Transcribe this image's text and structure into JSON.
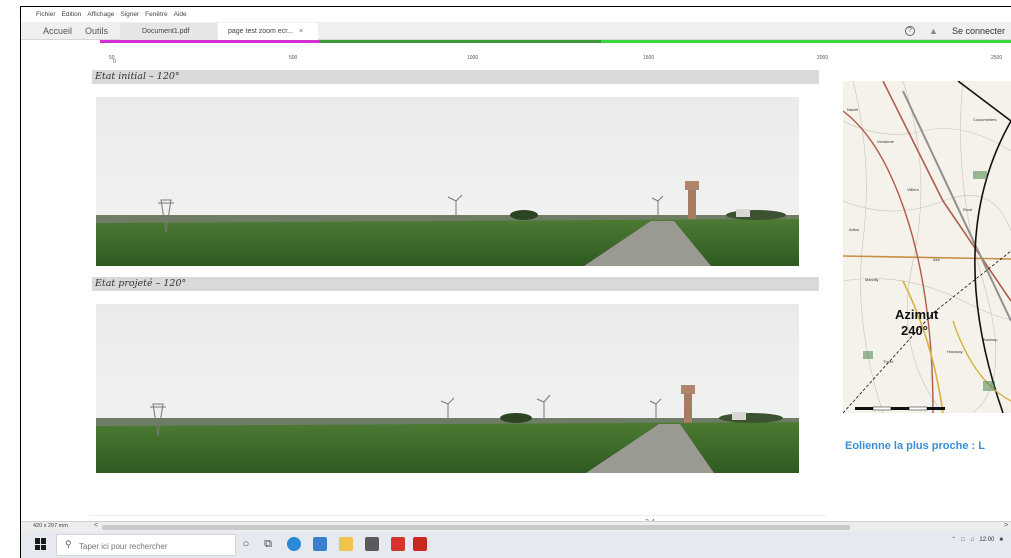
{
  "menu": [
    "Fichier",
    "Edition",
    "Affichage",
    "Signer",
    "Fenêtre",
    "Aide"
  ],
  "nav": {
    "home": "Accueil",
    "tools": "Outils"
  },
  "tabs": [
    {
      "label": "Document1.pdf",
      "active": false
    },
    {
      "label": "page test zoom ecr...",
      "active": true
    }
  ],
  "tab_close_glyph": "×",
  "header_right": {
    "signin": "Se connecter",
    "help_glyph": "?"
  },
  "ruler": {
    "ticks": [
      "50",
      "500",
      "1000",
      "1500",
      "2000",
      "2500"
    ],
    "zero": "0"
  },
  "progress": {
    "pink_fraction": 0.24,
    "green_fraction": 0.55
  },
  "sections": [
    {
      "title": "Etat initial – 120°"
    },
    {
      "title": "Etat projeté – 120°"
    }
  ],
  "map": {
    "azimut_label": "Azimut",
    "azimut_value": "240°",
    "place_labels": [
      "Vendôme",
      "Naveil",
      "Coulommiers",
      "Artins",
      "Villiers",
      "Azé",
      "Marcilly",
      "Thoré",
      "Houssay",
      "Rocé",
      "Busloup"
    ]
  },
  "caption": "Eolienne la plus proche : L",
  "page_number": "3 4",
  "status": {
    "page_size": "420 x 297 mm",
    "scroll_left": "<",
    "scroll_right": ">"
  },
  "taskbar": {
    "search_placeholder": "Taper ici pour rechercher",
    "time": "12:00"
  },
  "colors": {
    "accent_pink": "#d42fd4",
    "accent_green": "#3bd63b",
    "caption_blue": "#3a8fd6",
    "section_gray": "#d9d9d9"
  }
}
